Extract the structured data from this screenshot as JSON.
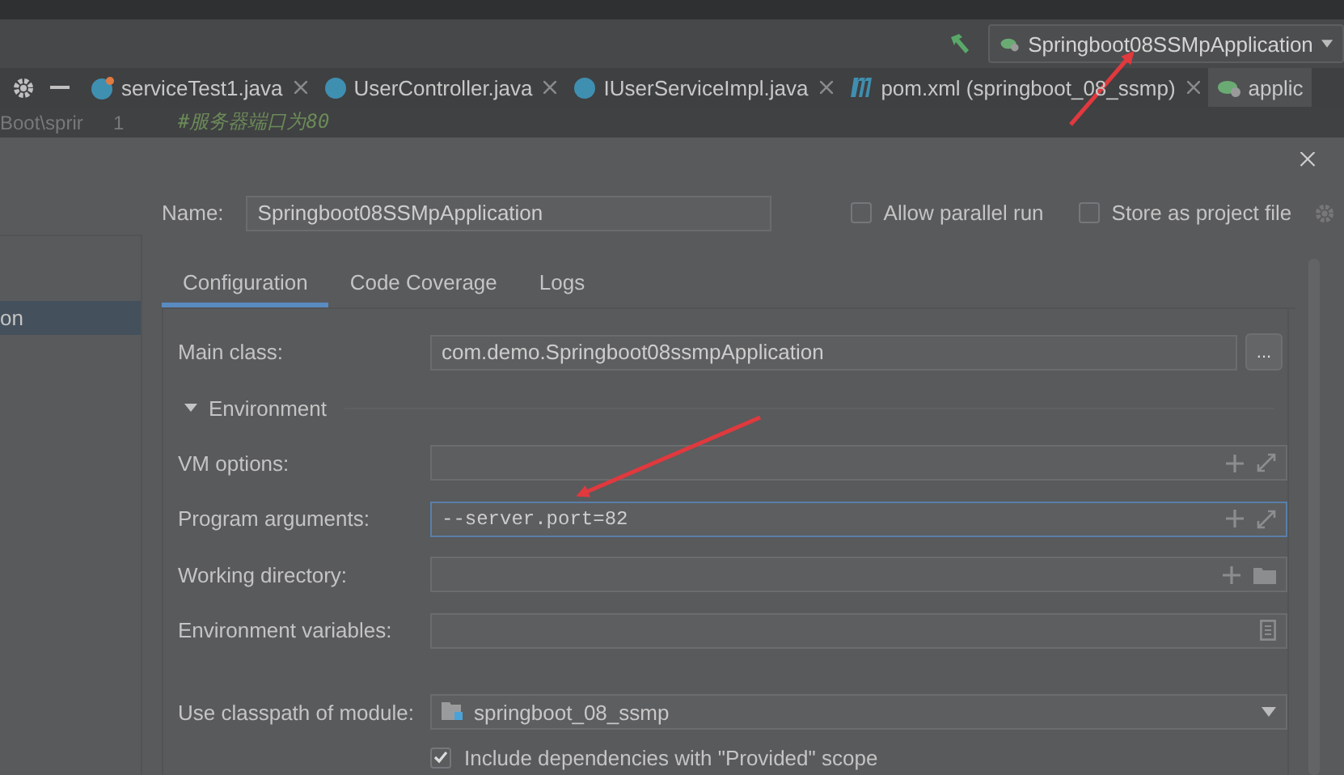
{
  "toolbar": {
    "run_config": "Springboot08SSMpApplication"
  },
  "editor_tabs": [
    {
      "label": "serviceTest1.java",
      "kind": "test",
      "selected": false
    },
    {
      "label": "UserController.java",
      "kind": "class",
      "selected": false
    },
    {
      "label": "IUserServiceImpl.java",
      "kind": "class",
      "selected": false
    },
    {
      "label": "pom.xml (springboot_08_ssmp)",
      "kind": "maven",
      "selected": false
    },
    {
      "label": "applic",
      "kind": "spring",
      "selected": true
    }
  ],
  "editor": {
    "path": "Boot\\sprir",
    "line_number": "1",
    "code": "#服务器端口为80"
  },
  "sidebar": {
    "items": [
      {
        "label": "on",
        "selected": true
      }
    ]
  },
  "dialog": {
    "name": {
      "label": "Name:",
      "value": "Springboot08SSMpApplication"
    },
    "options": [
      {
        "label": "Allow parallel run",
        "checked": false
      },
      {
        "label": "Store as project file",
        "checked": false
      }
    ],
    "tabs": [
      {
        "label": "Configuration",
        "selected": true
      },
      {
        "label": "Code Coverage",
        "selected": false
      },
      {
        "label": "Logs",
        "selected": false
      }
    ],
    "main_class": {
      "label": "Main class:",
      "value": "com.demo.Springboot08ssmpApplication",
      "button": "..."
    },
    "environment": {
      "label": "Environment",
      "expanded": true,
      "fields": [
        {
          "kind": "expandable",
          "label": "VM options:",
          "focused": false
        },
        {
          "kind": "expandable",
          "label": "Program arguments:",
          "value": "--server.port=82",
          "focused": true
        },
        {
          "kind": "directory",
          "label": "Working directory:",
          "focused": false
        },
        {
          "kind": "env",
          "label": "Environment variables:",
          "focused": false
        }
      ]
    },
    "module": {
      "label": "Use classpath of module:",
      "value": "springboot_08_ssmp"
    },
    "include": {
      "label": "Include dependencies with \"Provided\" scope",
      "checked": true
    }
  }
}
